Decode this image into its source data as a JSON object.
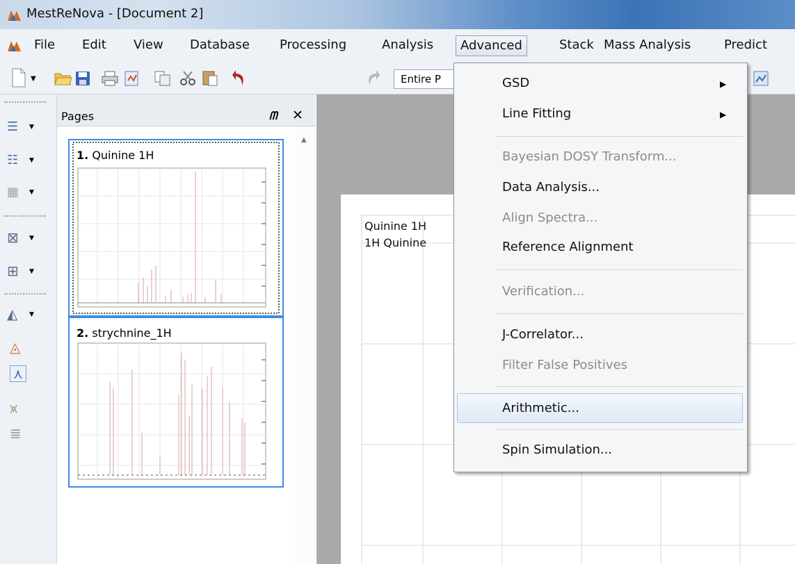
{
  "window": {
    "title": "MestReNova - [Document 2]"
  },
  "menubar": {
    "items": [
      "File",
      "Edit",
      "View",
      "Database",
      "Processing",
      "Analysis",
      "Advanced",
      "Stack",
      "Mass Analysis",
      "Predict"
    ],
    "active": "Advanced"
  },
  "toolbar": {
    "combo_value": "Entire P"
  },
  "pages_panel": {
    "title": "Pages",
    "pages": [
      {
        "number": "1.",
        "name": "Quinine 1H"
      },
      {
        "number": "2.",
        "name": "strychnine_1H"
      }
    ]
  },
  "document": {
    "line1": "Quinine 1H",
    "line2": "1H  Quinine"
  },
  "advanced_menu": {
    "items": [
      {
        "label": "GSD",
        "enabled": true,
        "submenu": true
      },
      {
        "label": "Line Fitting",
        "enabled": true,
        "submenu": true
      },
      {
        "label": "Bayesian DOSY Transform...",
        "enabled": false
      },
      {
        "label": "Data Analysis...",
        "enabled": true
      },
      {
        "label": "Align Spectra...",
        "enabled": false
      },
      {
        "label": "Reference Alignment",
        "enabled": true
      },
      {
        "label": "Verification...",
        "enabled": false
      },
      {
        "label": "J-Correlator...",
        "enabled": true
      },
      {
        "label": "Filter False Positives",
        "enabled": false
      },
      {
        "label": "Arithmetic...",
        "enabled": true,
        "highlighted": true
      },
      {
        "label": "Spin Simulation...",
        "enabled": true
      }
    ]
  },
  "colors": {
    "highlight": "#dfe9f6",
    "selection_border": "#3a8ee6",
    "workspace": "#a9a9a9"
  }
}
